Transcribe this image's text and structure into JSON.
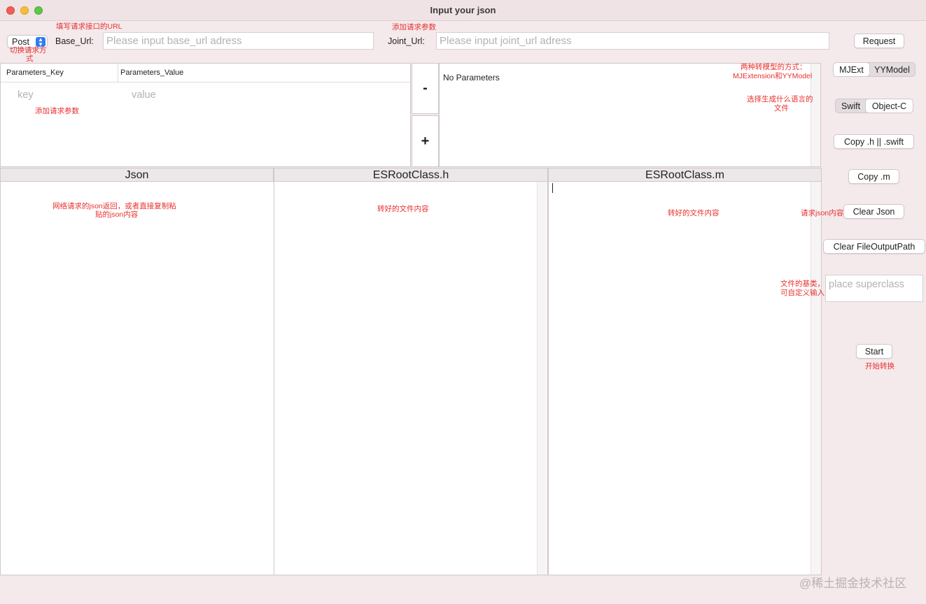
{
  "window": {
    "title": "Input your json"
  },
  "top": {
    "method": "Post",
    "base_url_label": "Base_Url:",
    "base_url_placeholder": "Please input base_url adress",
    "joint_url_label": "Joint_Url:",
    "joint_url_placeholder": "Please input joint_url adress",
    "request_button": "Request"
  },
  "params": {
    "key_header": "Parameters_Key",
    "value_header": "Parameters_Value",
    "key_placeholder": "key",
    "value_placeholder": "value",
    "minus_label": "-",
    "plus_label": "+",
    "preview_text": "No Parameters"
  },
  "right_panel": {
    "model_options": [
      "MJExt",
      "YYModel"
    ],
    "language_options": [
      "Swift",
      "Object-C"
    ],
    "copy_h_button": "Copy .h || .swift",
    "copy_m_button": "Copy .m",
    "clear_json_button": "Clear Json",
    "clear_output_button": "Clear FileOutputPath",
    "superclass_placeholder": "place superclass",
    "start_button": "Start"
  },
  "columns": {
    "json_header": "Json",
    "h_header": "ESRootClass.h",
    "m_header": "ESRootClass.m"
  },
  "annotations": {
    "url_hint": "填写请求接口的URL",
    "method_hint_1": "切换请求方",
    "method_hint_2": "式",
    "joint_hint": "添加请求参数",
    "params_hint": "添加请求参数",
    "model_hint_1": "两种转模型的方式：",
    "model_hint_2": "MJExtension和YYModel",
    "lang_hint_1": "选择生成什么语言的",
    "lang_hint_2": "文件",
    "json_hint_1": "网络请求的json返回，或者直接复制粘",
    "json_hint_2": "贴的json内容",
    "h_hint": "转好的文件内容",
    "m_hint": "转好的文件内容",
    "request_json_hint": "请求json内容",
    "superclass_hint_1": "文件的基类，",
    "superclass_hint_2": "可自定义输入",
    "start_hint": "开始转换"
  },
  "watermark": "@稀土掘金技术社区",
  "colors": {
    "annotation": "#e8302f",
    "select_accent": "#2f7cf6",
    "background": "#f4e9eb"
  }
}
